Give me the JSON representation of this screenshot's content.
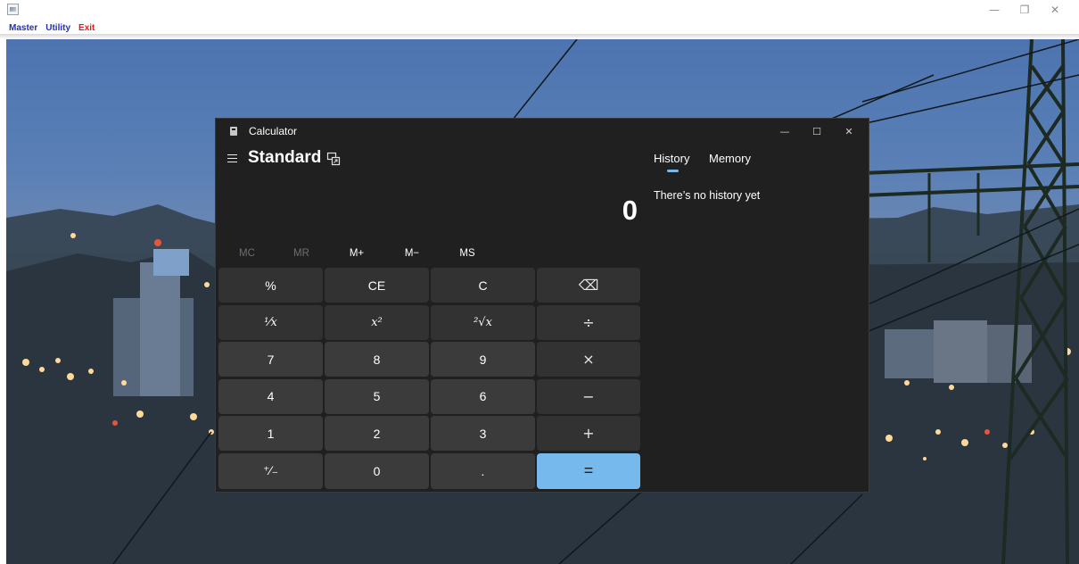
{
  "outer_window": {
    "controls": [
      "—",
      "❐",
      "✕"
    ]
  },
  "menu": {
    "items": [
      {
        "label": "Master"
      },
      {
        "label": "Utility"
      },
      {
        "label": "Exit"
      }
    ]
  },
  "calculator": {
    "title": "Calculator",
    "controls": [
      "—",
      "☐",
      "✕"
    ],
    "mode": "Standard",
    "display": "0",
    "memory": {
      "mc": "MC",
      "mr": "MR",
      "mplus": "M+",
      "mminus": "M−",
      "ms": "MS"
    },
    "keys": {
      "percent": "%",
      "ce": "CE",
      "c": "C",
      "backspace": "⌫",
      "reciprocal": "¹⁄x",
      "square": "x²",
      "sqrt": "²√x",
      "divide": "÷",
      "seven": "7",
      "eight": "8",
      "nine": "9",
      "multiply": "×",
      "four": "4",
      "five": "5",
      "six": "6",
      "minus": "−",
      "one": "1",
      "two": "2",
      "three": "3",
      "plus": "+",
      "negate": "⁺⁄₋",
      "zero": "0",
      "decimal": ".",
      "equals": "="
    },
    "side_panel": {
      "tabs": [
        "History",
        "Memory"
      ],
      "active_tab": "History",
      "empty_message": "There’s no history yet"
    }
  },
  "colors": {
    "accent": "#76b9ed",
    "calculator_bg": "#202020",
    "menu_link": "#1f2fbf",
    "menu_exit": "#e01a1a"
  }
}
